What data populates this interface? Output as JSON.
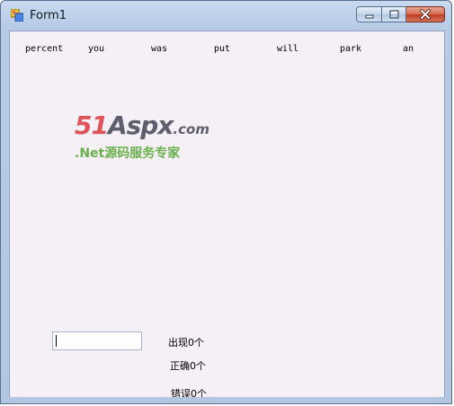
{
  "window": {
    "title": "Form1",
    "minimize_icon": "minimize-icon",
    "maximize_icon": "maximize-icon",
    "close_icon": "close-icon"
  },
  "words": [
    "percent",
    "you",
    "was",
    "put",
    "will",
    "park",
    "an"
  ],
  "logo": {
    "part1": "51",
    "part2": "Aspx",
    "part3": ".com",
    "tagline": ".Net源码服务专家"
  },
  "answer_input": {
    "value": ""
  },
  "stats": {
    "appeared": "出现0个",
    "correct": "正确0个",
    "wrong": "错误0个"
  },
  "colors": {
    "logo_red": "#e05359",
    "logo_green": "#6ab04c",
    "client_bg": "#f5f0f5"
  }
}
